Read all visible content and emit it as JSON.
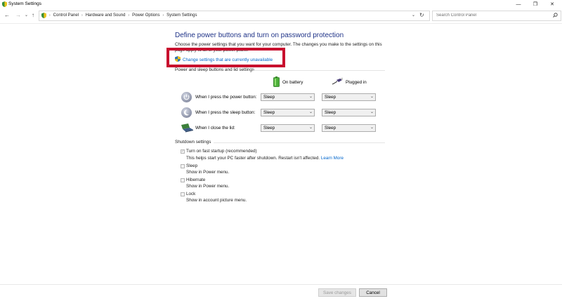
{
  "window": {
    "title": "System Settings",
    "minimize_glyph": "—",
    "maximize_glyph": "❐",
    "close_glyph": "✕"
  },
  "nav": {
    "back_glyph": "←",
    "forward_glyph": "→",
    "recent_glyph": "⌄",
    "up_glyph": "↑"
  },
  "address": {
    "breadcrumbs": [
      "Control Panel",
      "Hardware and Sound",
      "Power Options",
      "System Settings"
    ],
    "separator": "›",
    "dropdown_glyph": "⌄",
    "refresh_glyph": "↻"
  },
  "search": {
    "placeholder": "Search Control Panel",
    "icon": "search-icon"
  },
  "page": {
    "heading": "Define power buttons and turn on password protection",
    "description": "Choose the power settings that you want for your computer. The changes you make to the settings on this page apply to all of your power plans.",
    "change_link": "Change settings that are currently unavailable"
  },
  "power_section": {
    "label": "Power and sleep buttons and lid settings",
    "col_battery": "On battery",
    "col_plugged": "Plugged in",
    "rows": [
      {
        "label": "When I press the power button:",
        "battery": "Sleep",
        "plugged": "Sleep",
        "icon": "power-button-icon"
      },
      {
        "label": "When I press the sleep button:",
        "battery": "Sleep",
        "plugged": "Sleep",
        "icon": "sleep-button-icon"
      },
      {
        "label": "When I close the lid:",
        "battery": "Sleep",
        "plugged": "Sleep",
        "icon": "laptop-lid-icon"
      }
    ]
  },
  "shutdown_section": {
    "label": "Shutdown settings",
    "options": [
      {
        "label": "Turn on fast startup (recommended)",
        "sub": "This helps start your PC faster after shutdown. Restart isn't affected.",
        "link": "Learn More",
        "checked": true
      },
      {
        "label": "Sleep",
        "sub": "Show in Power menu.",
        "checked": false
      },
      {
        "label": "Hibernate",
        "sub": "Show in Power menu.",
        "checked": false
      },
      {
        "label": "Lock",
        "sub": "Show in account picture menu.",
        "checked": false
      }
    ]
  },
  "footer": {
    "save_label": "Save changes",
    "cancel_label": "Cancel"
  },
  "colors": {
    "heading": "#1e3287",
    "link": "#0066cc",
    "highlight_box": "#c8102e"
  }
}
